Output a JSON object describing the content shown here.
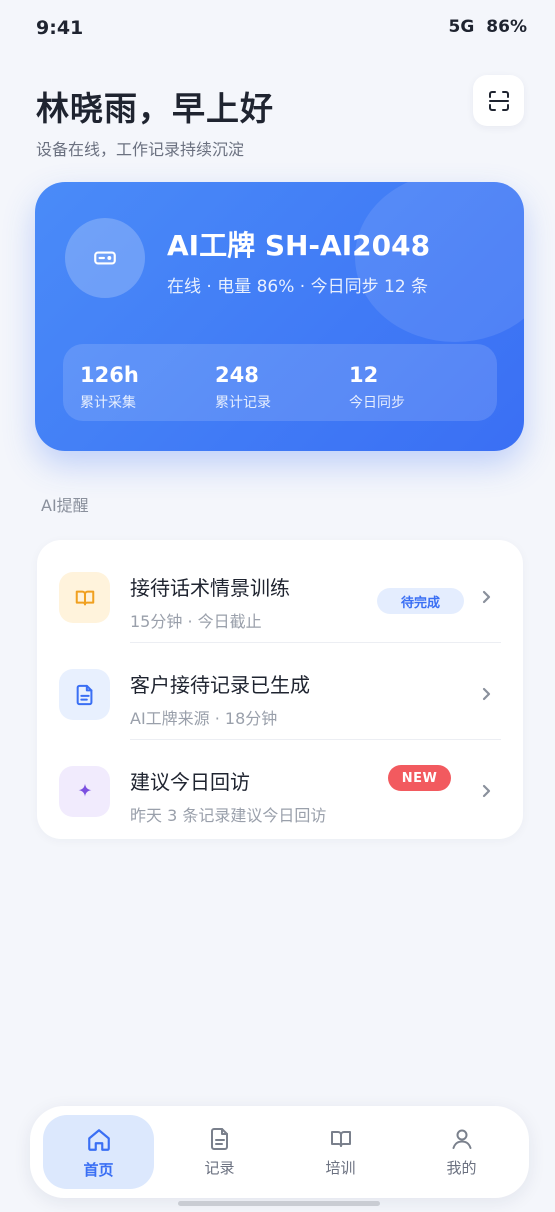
{
  "status_bar": {
    "time": "9:41",
    "network": "5G",
    "battery": "86%"
  },
  "header": {
    "greeting": "林晓雨，早上好",
    "subtitle": "设备在线，工作记录持续沉淀",
    "scan_icon": "scan-icon"
  },
  "device": {
    "name": "AI工牌 SH-AI2048",
    "status": "在线 · 电量 86% · 今日同步 12 条",
    "icon": "badge-device-icon",
    "stats": [
      {
        "value": "126h",
        "label": "累计采集"
      },
      {
        "value": "248",
        "label": "累计记录"
      },
      {
        "value": "12",
        "label": "今日同步"
      }
    ]
  },
  "reminders": {
    "section_title": "AI提醒",
    "items": [
      {
        "title": "接待话术情景训练",
        "meta": "15分钟 · 今日截止",
        "badge": "待完成",
        "icon": "book-icon"
      },
      {
        "title": "客户接待记录已生成",
        "meta": "AI工牌来源 · 18分钟",
        "icon": "document-icon"
      },
      {
        "title": "建议今日回访",
        "meta": "昨天 3 条记录建议今日回访",
        "badge": "NEW",
        "icon": "sparkle-icon"
      }
    ]
  },
  "nav": {
    "items": [
      {
        "label": "首页",
        "icon": "home-icon",
        "active": true
      },
      {
        "label": "记录",
        "icon": "document-icon"
      },
      {
        "label": "培训",
        "icon": "book-icon"
      },
      {
        "label": "我的",
        "icon": "user-icon"
      }
    ]
  },
  "colors": {
    "accent": "#3a6ff4",
    "card_gradient_start": "#4a8bf8",
    "pending_badge_bg": "#e4edfe",
    "new_badge_bg": "#f25a5f",
    "book_icon_bg": "#fff3dc",
    "document_icon_bg": "#e8f0fe",
    "sparkle_icon_bg": "#f1ebfd"
  }
}
